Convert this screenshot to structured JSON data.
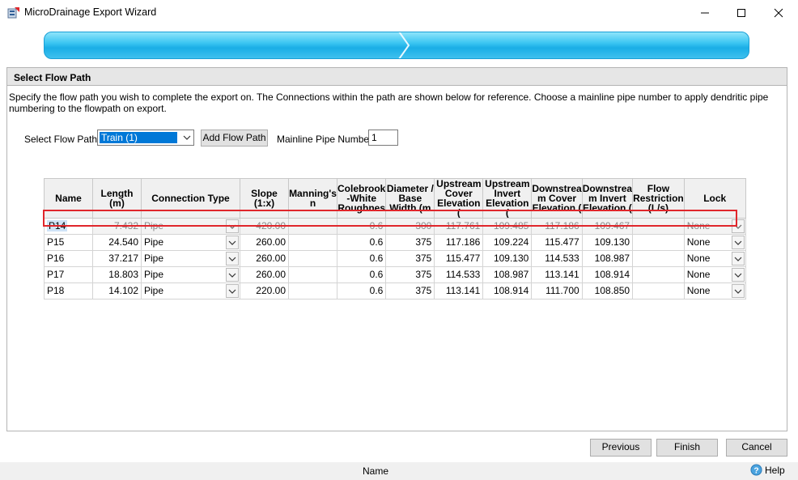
{
  "window": {
    "title": "MicroDrainage Export Wizard"
  },
  "section": {
    "title": "Select Flow Path",
    "description": "Specify the flow path you wish to complete the export on. The Connections within the path are shown below for reference. Choose a mainline pipe number to apply dendritic pipe numbering to the flowpath on export."
  },
  "controls": {
    "flow_path_label": "Select Flow Path",
    "flow_path_value": "Train (1)",
    "add_flow_path_label": "Add Flow Path",
    "mainline_label": "Mainline Pipe Number",
    "mainline_value": "1"
  },
  "grid": {
    "headers": [
      "Name",
      "Length (m)",
      "Connection Type",
      "Slope (1:x)",
      "Manning's n",
      "Colebrook -White Roughnes",
      "Diameter / Base Width (m",
      "Upstream Cover Elevation (",
      "Upstream Invert Elevation (",
      "Downstrea m Cover Elevation (",
      "Downstrea m Invert Elevation (",
      "Flow Restriction (L/s)",
      "Lock"
    ],
    "rows": [
      {
        "name": "P14",
        "length": "7.432",
        "type": "Pipe",
        "slope": "420.00",
        "manning": "",
        "colebrook": "0.6",
        "diameter": "300",
        "us_cover": "117.761",
        "us_invert": "109.485",
        "ds_cover": "117.186",
        "ds_invert": "109.467",
        "flow": "",
        "lock": "None"
      },
      {
        "name": "P15",
        "length": "24.540",
        "type": "Pipe",
        "slope": "260.00",
        "manning": "",
        "colebrook": "0.6",
        "diameter": "375",
        "us_cover": "117.186",
        "us_invert": "109.224",
        "ds_cover": "115.477",
        "ds_invert": "109.130",
        "flow": "",
        "lock": "None"
      },
      {
        "name": "P16",
        "length": "37.217",
        "type": "Pipe",
        "slope": "260.00",
        "manning": "",
        "colebrook": "0.6",
        "diameter": "375",
        "us_cover": "115.477",
        "us_invert": "109.130",
        "ds_cover": "114.533",
        "ds_invert": "108.987",
        "flow": "",
        "lock": "None"
      },
      {
        "name": "P17",
        "length": "18.803",
        "type": "Pipe",
        "slope": "260.00",
        "manning": "",
        "colebrook": "0.6",
        "diameter": "375",
        "us_cover": "114.533",
        "us_invert": "108.987",
        "ds_cover": "113.141",
        "ds_invert": "108.914",
        "flow": "",
        "lock": "None"
      },
      {
        "name": "P18",
        "length": "14.102",
        "type": "Pipe",
        "slope": "220.00",
        "manning": "",
        "colebrook": "0.6",
        "diameter": "375",
        "us_cover": "113.141",
        "us_invert": "108.914",
        "ds_cover": "111.700",
        "ds_invert": "108.850",
        "flow": "",
        "lock": "None"
      }
    ]
  },
  "footer": {
    "previous_label": "Previous",
    "finish_label": "Finish",
    "cancel_label": "Cancel"
  },
  "status": {
    "text": "Name",
    "help_label": "Help"
  },
  "colors": {
    "accent": "#1aaee6",
    "selection": "#0078d7",
    "highlight_border": "#e0262b"
  },
  "icons": [
    "app-icon",
    "minimize-icon",
    "maximize-icon",
    "close-icon",
    "chevron-down-icon",
    "help-icon"
  ]
}
